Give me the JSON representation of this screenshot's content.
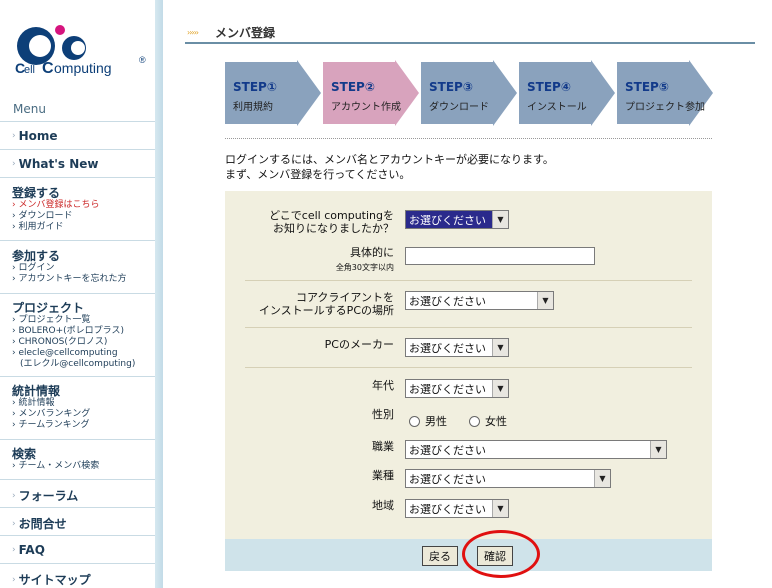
{
  "sidebar": {
    "logo": {
      "text": "ell",
      "text2": "omputing",
      "reg": "®"
    },
    "menu_title": "Menu",
    "items": [
      {
        "label": "Home"
      },
      {
        "label": "What's New"
      }
    ],
    "register": {
      "head": "登録する",
      "subs": [
        "メンバ登録はこちら",
        "ダウンロード",
        "利用ガイド"
      ]
    },
    "join": {
      "head": "参加する",
      "subs": [
        "ログイン",
        "アカウントキーを忘れた方"
      ]
    },
    "project": {
      "head": "プロジェクト",
      "subs": [
        "プロジェクト一覧",
        "BOLERO+(ボレロプラス)",
        "CHRONOS(クロノス)",
        "elecle@cellcomputing",
        "(エレクル@cellcomputing)"
      ]
    },
    "stats": {
      "head": "統計情報",
      "subs": [
        "統計情報",
        "メンバランキング",
        "チームランキング"
      ]
    },
    "search": {
      "head": "検索",
      "subs": [
        "チーム・メンバ検索"
      ]
    },
    "bottom_items": [
      {
        "label": "フォーラム"
      },
      {
        "label": "お問合せ"
      },
      {
        "label": "FAQ"
      },
      {
        "label": "サイトマップ"
      }
    ]
  },
  "page": {
    "title": "メンバ登録",
    "dots": "›››››"
  },
  "steps": [
    {
      "head": "STEP①",
      "sub": "利用規約",
      "color": "#8aa2bd",
      "active": false
    },
    {
      "head": "STEP②",
      "sub": "アカウント作成",
      "color": "#d8a3bd",
      "active": true
    },
    {
      "head": "STEP③",
      "sub": "ダウンロード",
      "color": "#8aa2bd",
      "active": false
    },
    {
      "head": "STEP④",
      "sub": "インストール",
      "color": "#8aa2bd",
      "active": false
    },
    {
      "head": "STEP⑤",
      "sub": "プロジェクト参加",
      "color": "#8aa2bd",
      "active": false
    }
  ],
  "intro": {
    "line1": "ログインするには、メンバ名とアカウントキーが必要になります。",
    "line2": "まず、メンバ登録を行ってください。"
  },
  "form": {
    "source": {
      "label1": "どこでcell computingを",
      "label2": "お知りになりましたか？",
      "value": "お選びください"
    },
    "detail": {
      "label1": "具体的に",
      "label2": "全角30文字以内",
      "value": ""
    },
    "install": {
      "label1": "コアクライアントを",
      "label2": "インストールするPCの場所",
      "value": "お選びください"
    },
    "maker": {
      "label": "PCのメーカー",
      "value": "お選びください"
    },
    "age": {
      "label": "年代",
      "value": "お選びください"
    },
    "gender": {
      "label": "性別",
      "male": "男性",
      "female": "女性"
    },
    "job": {
      "label": "職業",
      "value": "お選びください"
    },
    "industry": {
      "label": "業種",
      "value": "お選びください"
    },
    "region": {
      "label": "地域",
      "value": "お選びください"
    }
  },
  "buttons": {
    "back": "戻る",
    "confirm": "確認"
  }
}
